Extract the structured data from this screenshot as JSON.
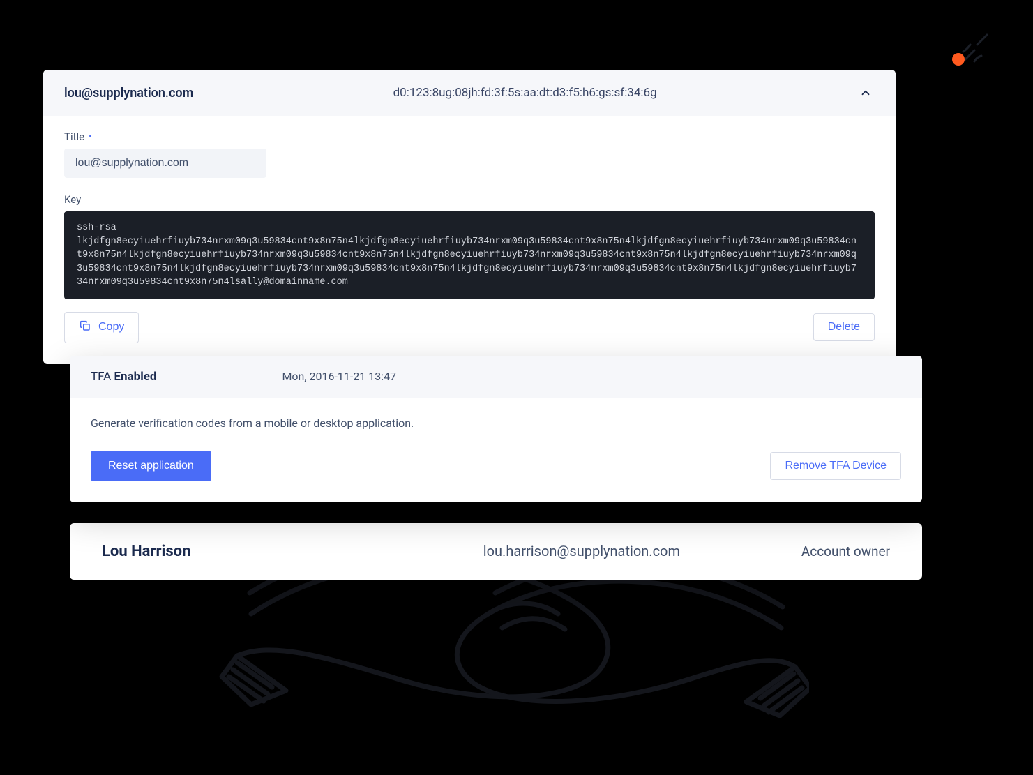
{
  "ssh": {
    "email": "lou@supplynation.com",
    "fingerprint": "d0:123:8ug:08jh:fd:3f:5s:aa:dt:d3:f5:h6:gs:sf:34:6g",
    "title_label": "Title",
    "title_value": "lou@supplynation.com",
    "key_label": "Key",
    "key_value": "ssh-rsa\nlkjdfgn8ecyiuehrfiuyb734nrxm09q3u59834cnt9x8n75n4lkjdfgn8ecyiuehrfiuyb734nrxm09q3u59834cnt9x8n75n4lkjdfgn8ecyiuehrfiuyb734nrxm09q3u59834cnt9x8n75n4lkjdfgn8ecyiuehrfiuyb734nrxm09q3u59834cnt9x8n75n4lkjdfgn8ecyiuehrfiuyb734nrxm09q3u59834cnt9x8n75n4lkjdfgn8ecyiuehrfiuyb734nrxm09q3u59834cnt9x8n75n4lkjdfgn8ecyiuehrfiuyb734nrxm09q3u59834cnt9x8n75n4lkjdfgn8ecyiuehrfiuyb734nrxm09q3u59834cnt9x8n75n4lkjdfgn8ecyiuehrfiuyb734nrxm09q3u59834cnt9x8n75n4lsally@domainname.com",
    "copy_label": "Copy",
    "delete_label": "Delete"
  },
  "tfa": {
    "prefix": "TFA",
    "status": "Enabled",
    "timestamp": "Mon, 2016-11-21  13:47",
    "description": "Generate verification codes from a mobile or desktop application.",
    "reset_label": "Reset application",
    "remove_label": "Remove TFA Device"
  },
  "user": {
    "name": "Lou Harrison",
    "email": "lou.harrison@supplynation.com",
    "role": "Account owner"
  }
}
